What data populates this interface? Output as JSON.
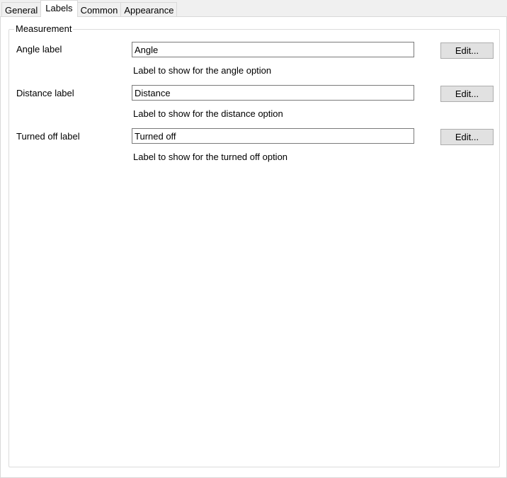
{
  "tabs": [
    {
      "label": "General"
    },
    {
      "label": "Labels"
    },
    {
      "label": "Common"
    },
    {
      "label": "Appearance"
    }
  ],
  "group": {
    "title": "Measurement",
    "rows": [
      {
        "label": "Angle label",
        "value": "Angle",
        "button": "Edit...",
        "hint": "Label to show for the angle option"
      },
      {
        "label": "Distance label",
        "value": "Distance",
        "button": "Edit...",
        "hint": "Label to show for the distance option"
      },
      {
        "label": "Turned off label",
        "value": "Turned off",
        "button": "Edit...",
        "hint": "Label to show for the turned off option"
      }
    ]
  }
}
